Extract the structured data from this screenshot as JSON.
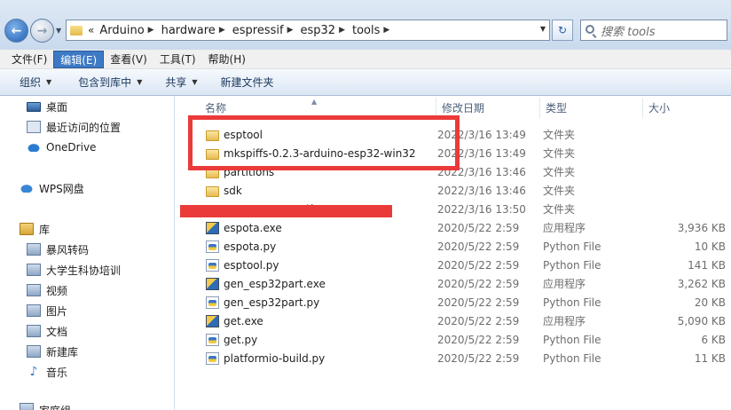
{
  "address": {
    "overflow_symbol": "«",
    "crumbs": [
      "Arduino",
      "hardware",
      "espressif",
      "esp32",
      "tools"
    ],
    "search_placeholder": "搜索 tools"
  },
  "menu": [
    "文件(F)",
    "编辑(E)",
    "查看(V)",
    "工具(T)",
    "帮助(H)"
  ],
  "menu_active_index": 1,
  "toolbar": {
    "organize": "组织",
    "include_in_library": "包含到库中",
    "share": "共享",
    "new_folder": "新建文件夹"
  },
  "nav": {
    "desktop": "桌面",
    "recent": "最近访问的位置",
    "onedrive": "OneDrive",
    "wps": "WPS网盘",
    "libraries": "库",
    "lib_items": [
      "暴风转码",
      "大学生科协培训",
      "视频",
      "图片",
      "文档",
      "新建库",
      "音乐"
    ],
    "partial_bottom": "家庭组"
  },
  "columns": {
    "name": "名称",
    "date": "修改日期",
    "type": "类型",
    "size": "大小"
  },
  "files": [
    {
      "name": "esptool",
      "date": "2022/3/16 13:49",
      "type": "文件夹",
      "size": "",
      "icon": "folder"
    },
    {
      "name": "mkspiffs-0.2.3-arduino-esp32-win32",
      "date": "2022/3/16 13:49",
      "type": "文件夹",
      "size": "",
      "icon": "folder"
    },
    {
      "name": "partitions",
      "date": "2022/3/16 13:46",
      "type": "文件夹",
      "size": "",
      "icon": "folder"
    },
    {
      "name": "sdk",
      "date": "2022/3/16 13:46",
      "type": "文件夹",
      "size": "",
      "icon": "folder"
    },
    {
      "name": "xtensa-esp32-elf",
      "date": "2022/3/16 13:50",
      "type": "文件夹",
      "size": "",
      "icon": "folder"
    },
    {
      "name": "espota.exe",
      "date": "2020/5/22 2:59",
      "type": "应用程序",
      "size": "3,936 KB",
      "icon": "exe"
    },
    {
      "name": "espota.py",
      "date": "2020/5/22 2:59",
      "type": "Python File",
      "size": "10 KB",
      "icon": "py"
    },
    {
      "name": "esptool.py",
      "date": "2020/5/22 2:59",
      "type": "Python File",
      "size": "141 KB",
      "icon": "py"
    },
    {
      "name": "gen_esp32part.exe",
      "date": "2020/5/22 2:59",
      "type": "应用程序",
      "size": "3,262 KB",
      "icon": "exe"
    },
    {
      "name": "gen_esp32part.py",
      "date": "2020/5/22 2:59",
      "type": "Python File",
      "size": "20 KB",
      "icon": "py"
    },
    {
      "name": "get.exe",
      "date": "2020/5/22 2:59",
      "type": "应用程序",
      "size": "5,090 KB",
      "icon": "exe"
    },
    {
      "name": "get.py",
      "date": "2020/5/22 2:59",
      "type": "Python File",
      "size": "6 KB",
      "icon": "py"
    },
    {
      "name": "platformio-build.py",
      "date": "2020/5/22 2:59",
      "type": "Python File",
      "size": "11 KB",
      "icon": "py"
    }
  ],
  "annotation_color": "#ea3a3a"
}
